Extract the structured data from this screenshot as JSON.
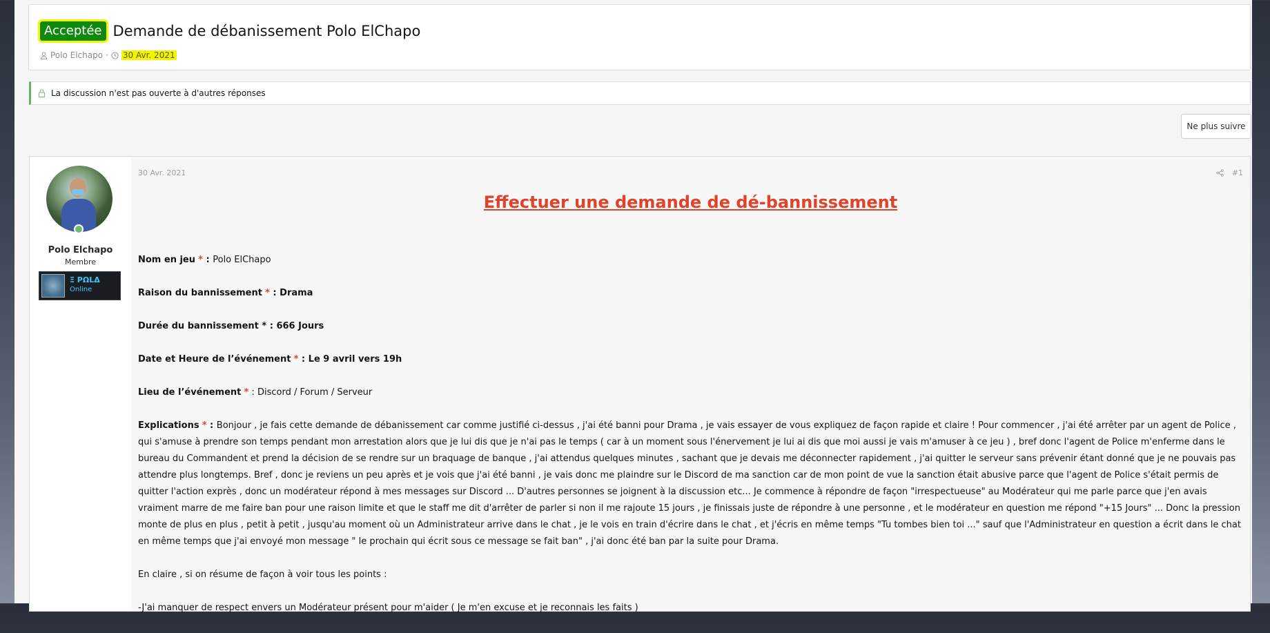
{
  "thread": {
    "prefix": "Acceptée",
    "title": "Demande de débanissement Polo ElChapo",
    "author": "Polo Elchapo",
    "date": "30 Avr. 2021",
    "separator": "·"
  },
  "notice": {
    "text": "La discussion n'est pas ouverte à d'autres réponses"
  },
  "actions": {
    "unfollow_label": "Ne plus suivre"
  },
  "post": {
    "date": "30 Avr. 2021",
    "number": "#1",
    "user": {
      "name": "Polo Elchapo",
      "title": "Membre",
      "banner_name": "Ξ ΡΩLΔ",
      "banner_status": "Online"
    },
    "heading": "Effectuer une demande de dé-bannissement",
    "fields": {
      "name_label": "Nom en jeu",
      "name_colon": " : ",
      "name_value": "Polo ElChapo",
      "reason_label": "Raison du bannissement",
      "reason_value": " : Drama",
      "duration_label": "Durée du bannissement * : 666 Jours",
      "datetime_label": "Date et Heure de l’événement",
      "datetime_value": " : Le 9 avril vers 19h",
      "place_label": "Lieu de l’événement",
      "place_colon": " : ",
      "place_value": "Discord / Forum / Serveur",
      "expl_label": "Explications",
      "expl_colon": " : ",
      "star": "*"
    },
    "explanation": "Bonjour , je fais cette demande de débanissement car comme justifié ci-dessus , j'ai été banni pour Drama , je vais essayer de vous expliquez de façon rapide et claire ! Pour commencer , j'ai été arrêter par un agent de Police , qui s'amuse à prendre son temps pendant mon arrestation alors que je lui dis que je n'ai pas le temps ( car à un moment sous l'énervement je lui ai dis que moi aussi je vais m'amuser à ce jeu ) , bref donc l'agent de Police m'enferme dans le bureau du Commandent et prend la décision de se rendre sur un braquage de banque , j'ai attendus quelques minutes , sachant que je devais me déconnecter rapidement , j'ai quitter le serveur sans prévenir étant donné que je ne pouvais pas attendre plus longtemps. Bref , donc je reviens un peu après et je vois que j'ai été banni , je vais donc me plaindre sur le Discord de ma sanction car de mon point de vue la sanction était abusive parce que l'agent de Police s'était permis de quitter l'action exprès , donc un modérateur répond à mes messages sur Discord ... D'autres personnes se joignent à la discussion etc... Je commence à répondre de façon \"irrespectueuse\" au Modérateur qui me parle parce que j'en avais vraiment marre de me faire ban pour une raison limite et que le staff me dit d'arrêter de parler si non il me rajoute 15 jours , je finissais juste de répondre à une personne , et le modérateur en question me répond \"+15 Jours\" ... Donc la pression monte de plus en plus , petit à petit , jusqu'au moment où un Administrateur arrive dans le chat , je le vois en train d'écrire dans le chat , et j'écris en même temps \"Tu tombes bien toi ...\" sauf que l'Administrateur en question a écrit dans le chat en même temps que j'ai envoyé mon message \" le prochain qui écrit sous ce message se fait ban\" , j'ai donc été ban par la suite pour Drama.",
    "summary_intro": "En claire , si on résume de façon à voir tous les points :",
    "summary_points": [
      "-J'ai manquer de respect envers un Modérateur présent pour m'aider ( Je m'en excuse et je reconnais les faits )"
    ]
  },
  "colors": {
    "accepted_bg": "#0f8a0f",
    "highlight": "#f4f400",
    "heading": "#e0432a",
    "notice_border": "#63b265"
  }
}
